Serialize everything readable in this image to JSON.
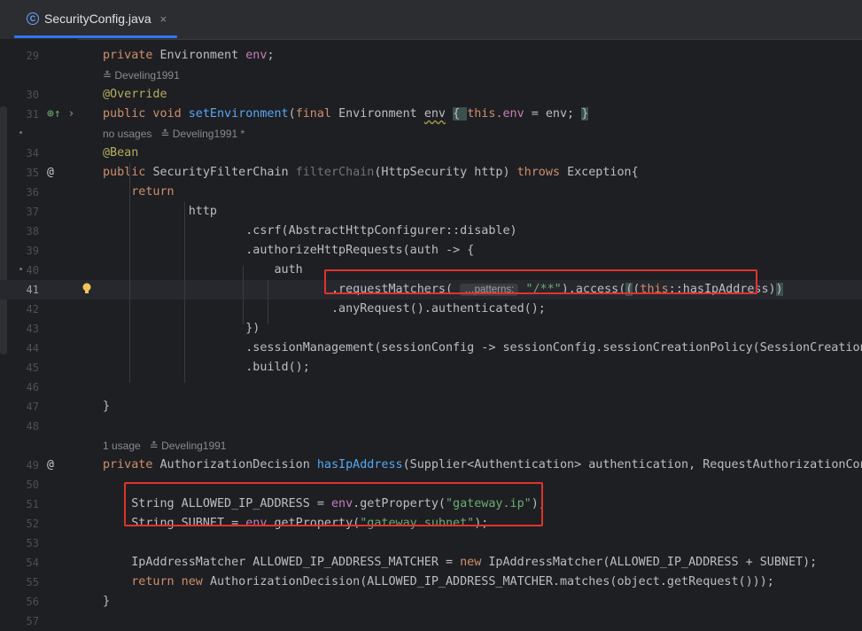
{
  "tab": {
    "icon": "class-c-icon",
    "filename": "SecurityConfig.java",
    "close": "×"
  },
  "rows": [
    {
      "n": "29",
      "t": "code",
      "segs": [
        [
          "kw",
          "private "
        ],
        [
          "",
          "Environment "
        ],
        [
          "fd",
          "env"
        ],
        [
          "",
          ";"
        ]
      ]
    },
    {
      "t": "meta",
      "text": "≛ Develing1991"
    },
    {
      "n": "30",
      "t": "code",
      "segs": [
        [
          "an",
          "@Override"
        ]
      ]
    },
    {
      "n": "31",
      "t": "code",
      "icon": "override-method-icon",
      "segs": [
        [
          "kw",
          "public void "
        ],
        [
          "fn",
          "setEnvironment"
        ],
        [
          "",
          "("
        ],
        [
          "kw",
          "final "
        ],
        [
          "",
          "Environment "
        ],
        [
          "un",
          "env"
        ],
        [
          "",
          " "
        ],
        [
          "brace",
          "{ "
        ],
        [
          "kw",
          "this"
        ],
        [
          "",
          ""
        ],
        [
          "fd",
          ".env"
        ],
        [
          "",
          " = env; "
        ],
        [
          "brace",
          "}"
        ]
      ]
    },
    {
      "t": "meta",
      "text": "no usages   ≛ Develing1991 *"
    },
    {
      "n": "34",
      "t": "code",
      "segs": [
        [
          "an",
          "@Bean"
        ]
      ]
    },
    {
      "n": "35",
      "t": "code",
      "icon": "bean-icon",
      "segs": [
        [
          "kw",
          "public "
        ],
        [
          "",
          "SecurityFilterChain "
        ],
        [
          "gr",
          "filterChain"
        ],
        [
          "",
          "(HttpSecurity http) "
        ],
        [
          "kw",
          "throws "
        ],
        [
          "",
          "Exception{"
        ]
      ]
    },
    {
      "n": "36",
      "t": "code",
      "segs": [
        [
          "",
          "    "
        ],
        [
          "kw",
          "return"
        ]
      ]
    },
    {
      "n": "37",
      "t": "code",
      "segs": [
        [
          "",
          "            http"
        ]
      ]
    },
    {
      "n": "38",
      "t": "code",
      "segs": [
        [
          "",
          "                    .csrf(AbstractHttpConfigurer::disable)"
        ]
      ]
    },
    {
      "n": "39",
      "t": "code",
      "segs": [
        [
          "",
          "                    .authorizeHttpRequests(auth -> {"
        ]
      ]
    },
    {
      "n": "40",
      "t": "code",
      "segs": [
        [
          "",
          "                        auth"
        ]
      ]
    },
    {
      "n": "41",
      "t": "code",
      "current": true,
      "bulb": true,
      "segs": [
        [
          "",
          "                                .requestMatchers( "
        ],
        [
          "hint",
          "…patterns:"
        ],
        [
          "",
          " "
        ],
        [
          "st",
          "\"/**\""
        ],
        [
          "",
          ").access("
        ],
        [
          "brace",
          "("
        ],
        [
          "",
          "("
        ],
        [
          "kw",
          "this"
        ],
        [
          "",
          "::hasIpAddress)"
        ],
        [
          "brace",
          ")"
        ]
      ]
    },
    {
      "n": "42",
      "t": "code",
      "segs": [
        [
          "",
          "                                .anyRequest().authenticated();"
        ]
      ]
    },
    {
      "n": "43",
      "t": "code",
      "segs": [
        [
          "",
          "                    })"
        ]
      ]
    },
    {
      "n": "44",
      "t": "code",
      "segs": [
        [
          "",
          "                    .sessionManagement(sessionConfig -> sessionConfig.sessionCreationPolicy(SessionCreationPol"
        ]
      ]
    },
    {
      "n": "45",
      "t": "code",
      "segs": [
        [
          "",
          "                    .build();"
        ]
      ]
    },
    {
      "n": "46",
      "t": "code",
      "segs": []
    },
    {
      "n": "47",
      "t": "code",
      "segs": [
        [
          "",
          "}"
        ]
      ]
    },
    {
      "n": "48",
      "t": "code",
      "segs": []
    },
    {
      "t": "meta",
      "text": "1 usage   ≛ Develing1991"
    },
    {
      "n": "49",
      "t": "code",
      "icon": "bean-icon",
      "segs": [
        [
          "kw",
          "private "
        ],
        [
          "",
          "AuthorizationDecision "
        ],
        [
          "fn",
          "hasIpAddress"
        ],
        [
          "",
          "(Supplier<Authentication> authentication, RequestAuthorizationContex"
        ]
      ]
    },
    {
      "n": "50",
      "t": "code",
      "segs": []
    },
    {
      "n": "51",
      "t": "code",
      "segs": [
        [
          "",
          "    String ALLOWED_IP_ADDRESS = "
        ],
        [
          "fd",
          "env"
        ],
        [
          "",
          ".getProperty("
        ],
        [
          "st",
          "\"gateway.ip\""
        ],
        [
          "",
          ");"
        ]
      ]
    },
    {
      "n": "52",
      "t": "code",
      "segs": [
        [
          "",
          "    String SUBNET = "
        ],
        [
          "fd",
          "env"
        ],
        [
          "",
          ".getProperty("
        ],
        [
          "st",
          "\"gateway.subnet\""
        ],
        [
          "",
          ");"
        ]
      ]
    },
    {
      "n": "53",
      "t": "code",
      "segs": []
    },
    {
      "n": "54",
      "t": "code",
      "segs": [
        [
          "",
          "    IpAddressMatcher ALLOWED_IP_ADDRESS_MATCHER = "
        ],
        [
          "kw",
          "new "
        ],
        [
          "",
          "IpAddressMatcher(ALLOWED_IP_ADDRESS + SUBNET);"
        ]
      ]
    },
    {
      "n": "55",
      "t": "code",
      "segs": [
        [
          "",
          "    "
        ],
        [
          "kw",
          "return new "
        ],
        [
          "",
          "AuthorizationDecision(ALLOWED_IP_ADDRESS_MATCHER.matches(object.getRequest()));"
        ]
      ]
    },
    {
      "n": "56",
      "t": "code",
      "segs": [
        [
          "",
          "}"
        ]
      ]
    },
    {
      "n": "57",
      "t": "code",
      "segs": []
    }
  ]
}
